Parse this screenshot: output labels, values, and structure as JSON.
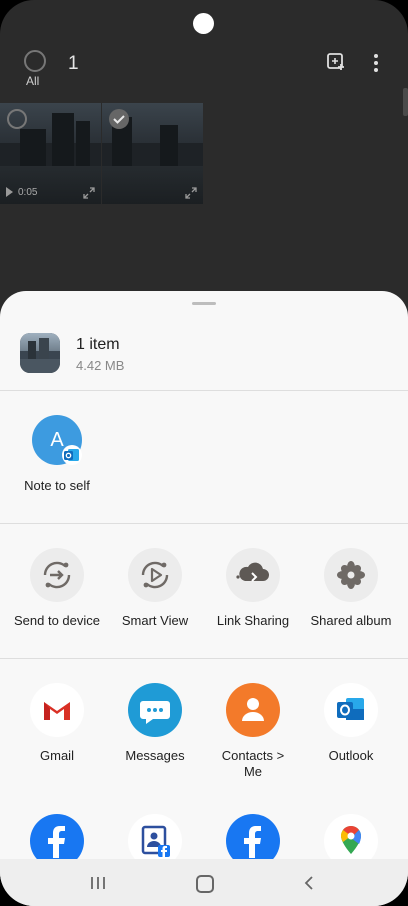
{
  "gallery": {
    "select_all_label": "All",
    "selected_count": "1",
    "thumbnails": [
      {
        "duration": "0:05",
        "selected": false
      },
      {
        "duration": "",
        "selected": true
      }
    ]
  },
  "share_sheet": {
    "item_title": "1 item",
    "item_size": "4.42 MB",
    "contact": {
      "initial": "A",
      "label": "Note to self"
    },
    "quick_actions": [
      {
        "label": "Send to device",
        "icon": "send-to-device-icon"
      },
      {
        "label": "Smart View",
        "icon": "smart-view-icon"
      },
      {
        "label": "Link Sharing",
        "icon": "link-sharing-icon"
      },
      {
        "label": "Shared album",
        "icon": "shared-album-icon"
      }
    ],
    "apps": [
      {
        "label": "Gmail",
        "icon": "gmail-icon"
      },
      {
        "label": "Messages",
        "icon": "messages-icon"
      },
      {
        "label": "Contacts > Me",
        "icon": "contacts-icon"
      },
      {
        "label": "Outlook",
        "icon": "outlook-icon"
      }
    ],
    "apps_row2_icons": [
      "facebook-icon",
      "facebook-pages-icon",
      "facebook-icon",
      "google-maps-icon"
    ]
  },
  "colors": {
    "messages": "#1f9bd6",
    "contacts": "#f37a2a",
    "facebook": "#1877f2",
    "outlook": "#0f6cbd",
    "avatar": "#3d9be0"
  }
}
